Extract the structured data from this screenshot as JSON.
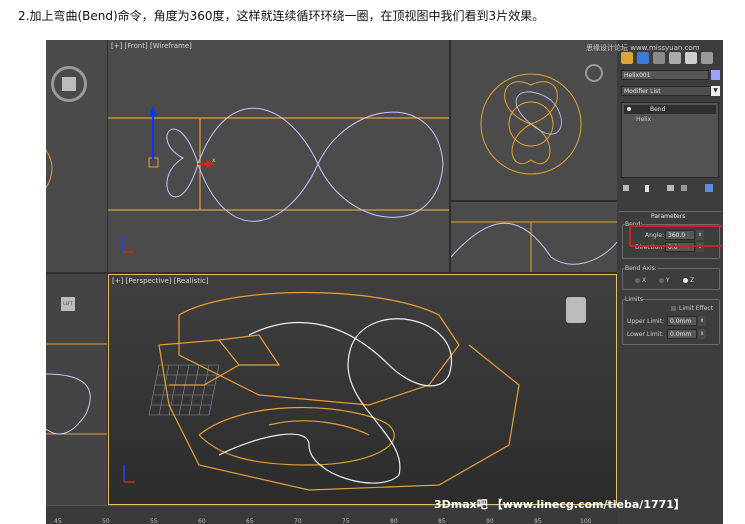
{
  "caption": "2.加上弯曲(Bend)命令，角度为360度，这样就连续循环环绕一圈，在顶视图中我们看到3片效果。",
  "viewports": {
    "front_label": "[+] [Front] [Wireframe]",
    "perspective_label": "[+] [Perspective] [Realistic]",
    "front_axis_x": "x",
    "viewcube_left_top": "LEFT",
    "viewcube_left_bottom": "LEFT"
  },
  "panel": {
    "object_name": "Helix001",
    "modifier_list": "Modifier List",
    "stack": [
      "Bend",
      "Helix"
    ],
    "rollout_title": "Parameters",
    "bend_group": "Bend:",
    "angle_label": "Angle:",
    "angle_value": "360.0",
    "direction_label": "Direction:",
    "direction_value": "0.0",
    "bend_axis_group": "Bend Axis:",
    "axis_x": "X",
    "axis_y": "Y",
    "axis_z": "Z",
    "selected_axis": "Z",
    "limits_group": "Limits",
    "limit_effect": "Limit Effect",
    "upper_limit_label": "Upper Limit:",
    "upper_limit_value": "0.0mm",
    "lower_limit_label": "Lower Limit:",
    "lower_limit_value": "0.0mm"
  },
  "ruler_ticks": [
    "45",
    "50",
    "55",
    "60",
    "65",
    "70",
    "75",
    "80",
    "85",
    "90",
    "95",
    "100"
  ],
  "watermark": "3Dmax吧 【www.linecg.com/tieba/1771】",
  "top_watermark": "思缘设计论坛 www.missyuan.com",
  "colors": {
    "highlight_box": "#cc2222",
    "helix": "#e6a030",
    "curve": "#c8c8ff"
  }
}
